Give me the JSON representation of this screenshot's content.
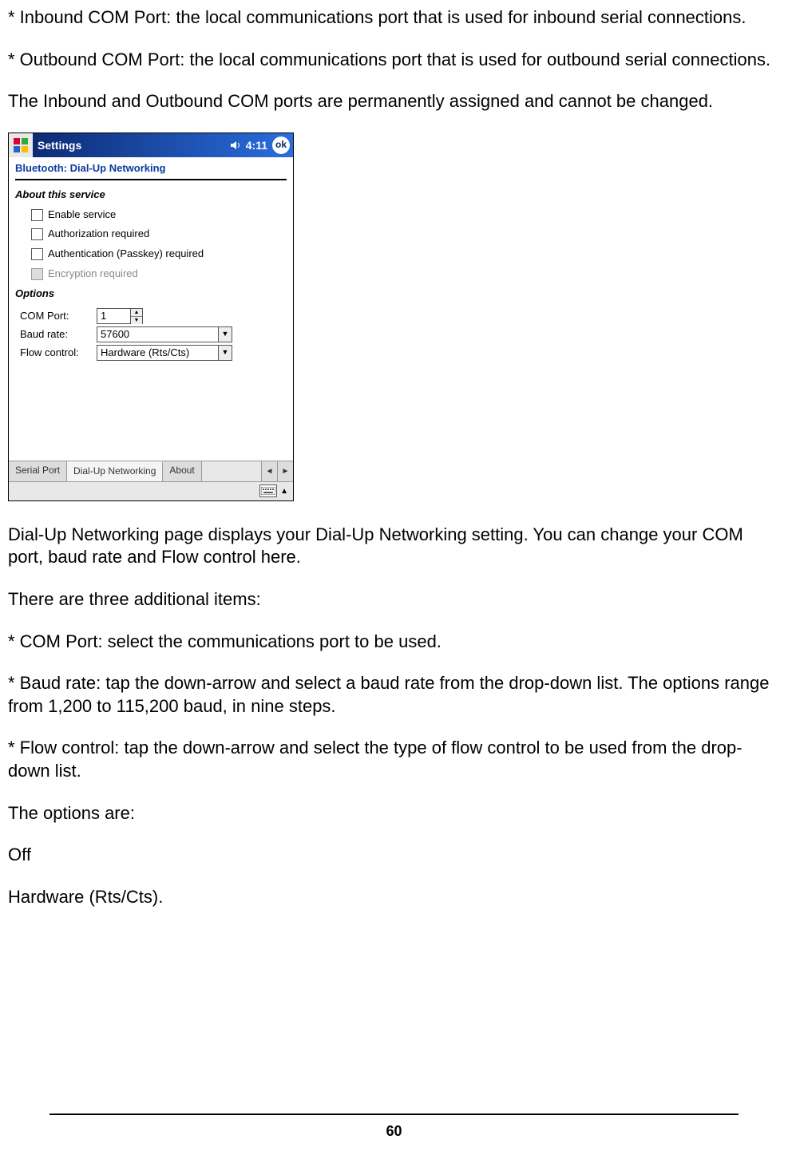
{
  "page_number": "60",
  "paragraphs": {
    "inbound": "* Inbound COM Port: the local communications port that is used for inbound serial connections.",
    "outbound": "* Outbound COM Port: the local communications port that is used for outbound serial connections.",
    "note": "The Inbound and Outbound COM ports are permanently assigned and cannot be changed.",
    "dun_intro": "Dial-Up Networking page displays your Dial-Up Networking setting. You can change your COM port, baud rate and Flow control here.",
    "three_items": "There are three additional items:",
    "item_com": "* COM Port: select the communications port to be used.",
    "item_baud": "* Baud rate: tap the down-arrow and select a baud rate from the drop-down list. The options range from 1,200 to 115,200 baud, in nine steps.",
    "item_flow": "* Flow control: tap the down-arrow and select the type of flow control to be used from the drop-down list.",
    "options_are": "The options are:",
    "off": "Off",
    "hw": "Hardware (Rts/Cts)."
  },
  "screenshot": {
    "titlebar": {
      "title": "Settings",
      "time": "4:11",
      "ok": "ok"
    },
    "subheader": "Bluetooth: Dial-Up Networking",
    "about_section": "About this service",
    "checkboxes": {
      "enable": "Enable service",
      "auth": "Authorization required",
      "passkey": "Authentication (Passkey) required",
      "encrypt": "Encryption required"
    },
    "options_section": "Options",
    "options": {
      "com_label": "COM Port:",
      "com_value": "1",
      "baud_label": "Baud rate:",
      "baud_value": "57600",
      "flow_label": "Flow control:",
      "flow_value": "Hardware (Rts/Cts)"
    },
    "tabs": {
      "serial": "Serial Port",
      "dun": "Dial-Up Networking",
      "about": "About"
    }
  }
}
